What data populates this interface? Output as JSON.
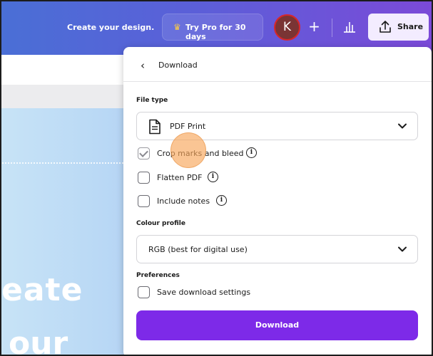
{
  "topbar": {
    "create_text": "Create your design.",
    "pro_label": "Try Pro for 30 days",
    "avatar_initial": "K",
    "share_label": "Share"
  },
  "canvas": {
    "line1": "eate",
    "line2": "our"
  },
  "download_panel": {
    "title": "Download",
    "file_type_label": "File type",
    "file_type_value": "PDF Print",
    "options": [
      {
        "label": "Crop marks and bleed",
        "checked": true,
        "info": true
      },
      {
        "label": "Flatten PDF",
        "checked": false,
        "info": true
      },
      {
        "label": "Include notes",
        "checked": false,
        "info": true
      }
    ],
    "colour_profile_label": "Colour profile",
    "colour_profile_value": "RGB (best for digital use)",
    "preferences_label": "Preferences",
    "save_settings_label": "Save download settings",
    "download_button": "Download"
  },
  "colors": {
    "accent": "#7d2ae8",
    "topbar_start": "#4a6fd6",
    "topbar_end": "#7b4ad8",
    "cursor_highlight": "#f7a65a"
  }
}
